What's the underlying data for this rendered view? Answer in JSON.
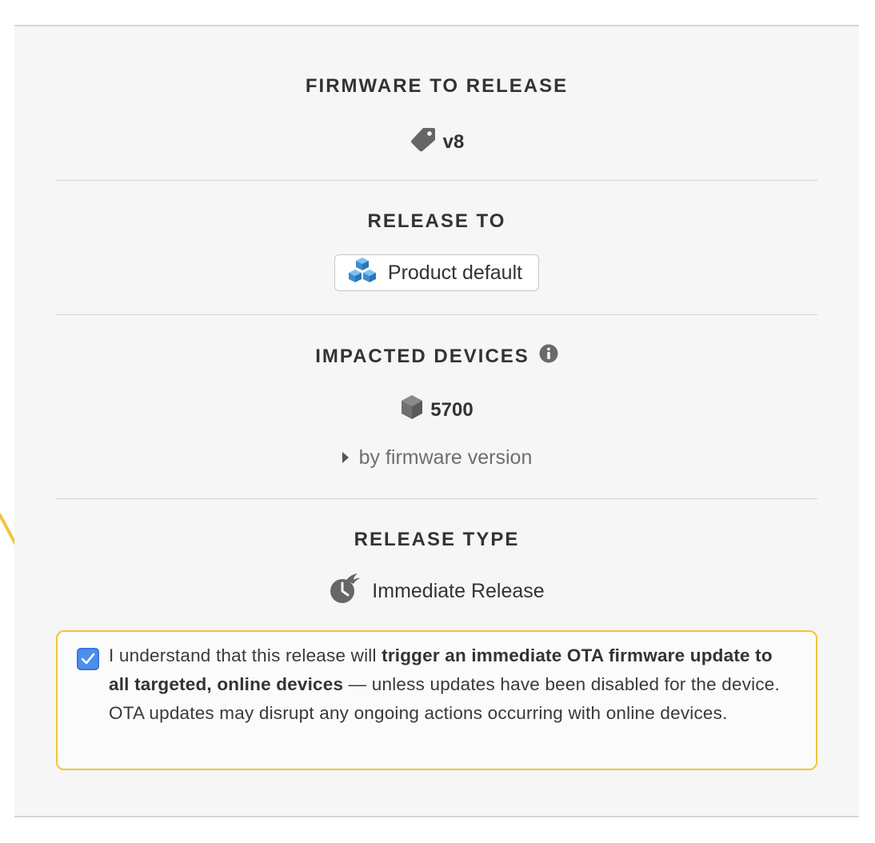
{
  "firmware": {
    "heading": "FIRMWARE TO RELEASE",
    "version": "v8",
    "icon": "tag-icon"
  },
  "release_to": {
    "heading": "RELEASE TO",
    "group_label": "Product default",
    "icon": "cubes-icon",
    "icon_color": "#4a9fd8"
  },
  "impacted_devices": {
    "heading": "IMPACTED DEVICES",
    "info_icon": "info-icon",
    "count": "5700",
    "count_icon": "cube-icon",
    "breakdown_label": "by firmware version"
  },
  "release_type": {
    "heading": "RELEASE TYPE",
    "label": "Immediate Release",
    "icon": "fast-clock-icon"
  },
  "acknowledgement": {
    "checked": true,
    "text_intro": "I understand that this release will ",
    "text_bold": "trigger an immediate OTA firmware update to all targeted, online devices",
    "text_rest": " — unless updates have been disabled for the device. OTA updates may disrupt any ongoing actions occurring with online devices.",
    "border_color": "#f0c53a",
    "checkbox_color": "#4a8ef0"
  },
  "annotation_arrow": {
    "color": "#f2c540"
  }
}
